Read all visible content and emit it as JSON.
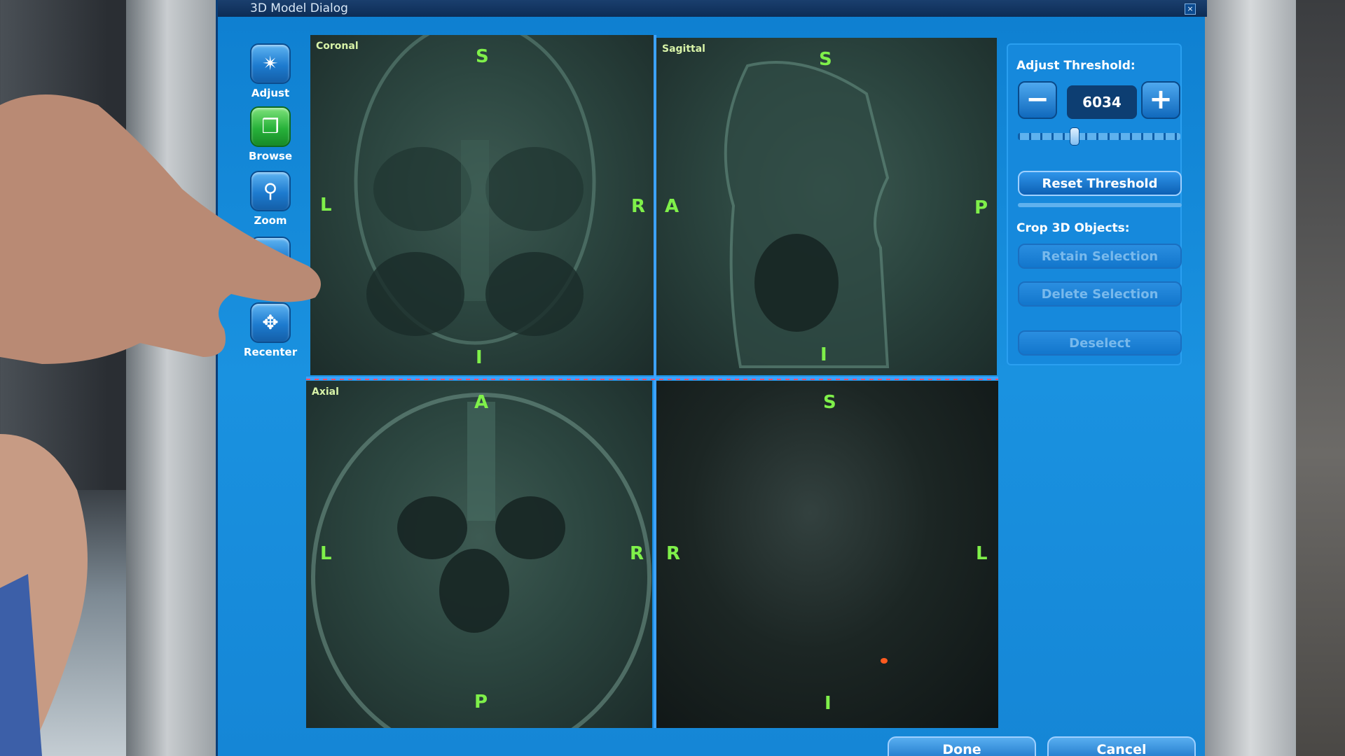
{
  "window": {
    "title": "3D Model Dialog",
    "close_glyph": "×"
  },
  "toolbar": {
    "items": [
      {
        "label": "Adjust",
        "icon": "adjust-icon",
        "glyph": "✴"
      },
      {
        "label": "Browse",
        "icon": "browse-cube-icon",
        "glyph": "❒"
      },
      {
        "label": "Zoom",
        "icon": "magnifier-icon",
        "glyph": "⚲"
      },
      {
        "label": "",
        "icon": "partially-hidden-icon",
        "glyph": "⟡"
      },
      {
        "label": "Recenter",
        "icon": "recenter-arrows-icon",
        "glyph": "✥"
      }
    ]
  },
  "viewports": {
    "coronal": {
      "name": "Coronal",
      "top": "S",
      "bottom": "I",
      "left": "L",
      "right": "R"
    },
    "sagittal": {
      "name": "Sagittal",
      "top": "S",
      "bottom": "I",
      "left": "A",
      "right": "P"
    },
    "axial": {
      "name": "Axial",
      "top": "A",
      "bottom": "P",
      "left": "L",
      "right": "R"
    },
    "render3d": {
      "name": "",
      "top": "S",
      "bottom": "I",
      "left": "R",
      "right": "L"
    }
  },
  "threshold": {
    "label": "Adjust Threshold:",
    "value": "6034",
    "minus_glyph": "−",
    "plus_glyph": "+",
    "slider_fraction": 0.35,
    "reset_label": "Reset Threshold"
  },
  "crop": {
    "label": "Crop 3D Objects:",
    "retain_label": "Retain Selection",
    "delete_label": "Delete Selection",
    "deselect_label": "Deselect"
  },
  "footer": {
    "done_label": "Done",
    "cancel_label": "Cancel"
  },
  "colors": {
    "dialog_blue": "#1586d6",
    "orientation_green": "#7ff04a",
    "divider_blue": "#3da2ff"
  }
}
